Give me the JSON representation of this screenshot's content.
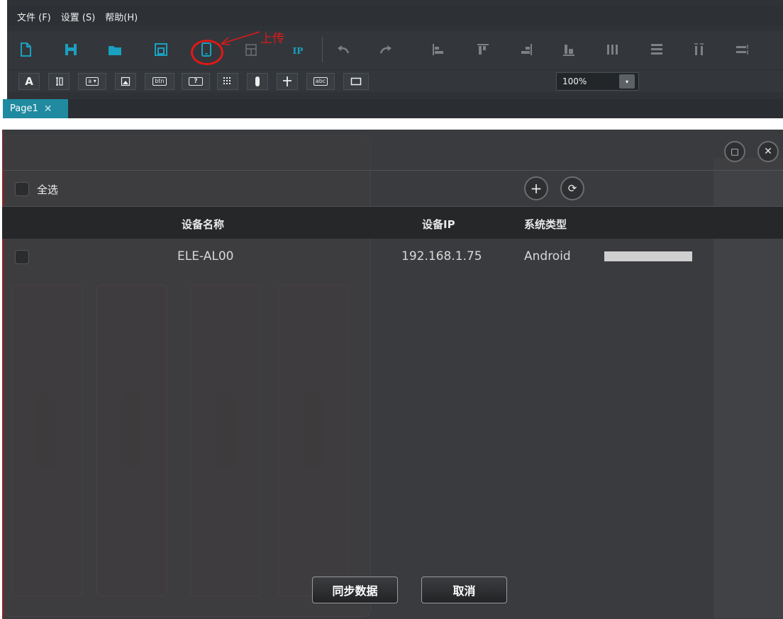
{
  "menubar": {
    "items": [
      "文件 (F)",
      "设置 (S)",
      "帮助(H)"
    ]
  },
  "toolbar": {
    "upload_annotation": "上传",
    "ip_label": "IP",
    "zoom": "100%",
    "zoom_arrow": "▾",
    "widgets": {
      "text": "A",
      "combo": "a ▾",
      "button": "btn",
      "help": "?",
      "label": "abc"
    }
  },
  "tabs": [
    {
      "label": "Page1",
      "close": "✕"
    }
  ],
  "dialog": {
    "select_all": "全选",
    "add_icon": "+",
    "refresh_icon": "⟳",
    "restore_icon": "□",
    "close_icon": "✕",
    "columns": [
      "设备名称",
      "设备IP",
      "系统类型"
    ],
    "devices": [
      {
        "name": "ELE-AL00",
        "ip": "192.168.1.75",
        "os": "Android",
        "progress": 1.0
      }
    ],
    "sync_button": "同步数据",
    "cancel_button": "取消"
  },
  "colors": {
    "accent": "#1aa0c0",
    "annotation": "#e01818",
    "tab_active": "#1f8aa0"
  }
}
